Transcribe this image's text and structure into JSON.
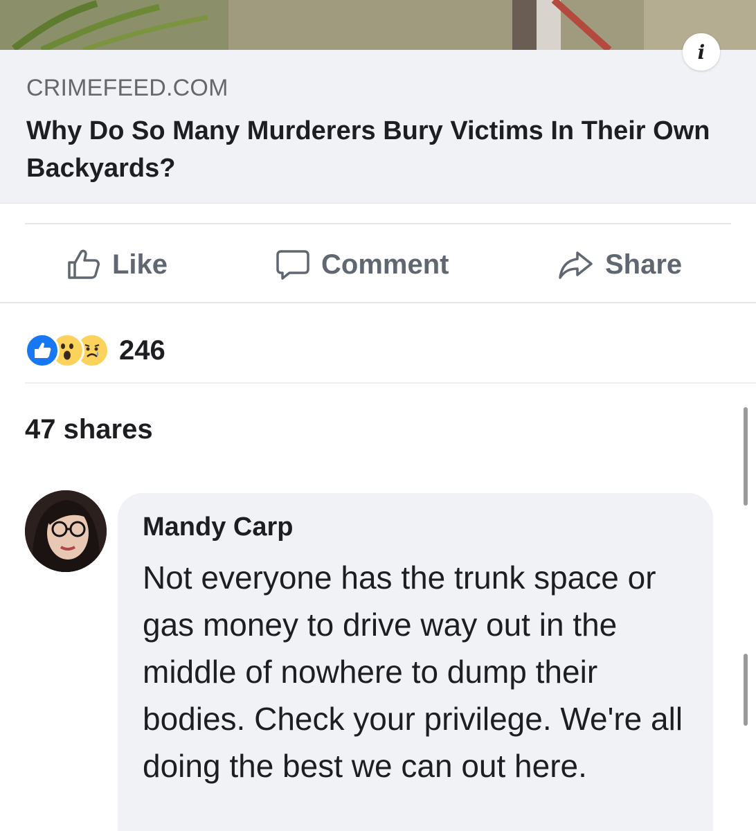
{
  "link_preview": {
    "domain": "CRIMEFEED.COM",
    "headline": "Why Do So Many Murderers Bury Victims In Their Own Backyards?",
    "info_icon": "info-icon",
    "info_label": "i"
  },
  "actions": {
    "like_label": "Like",
    "comment_label": "Comment",
    "share_label": "Share"
  },
  "reactions": {
    "icons": [
      "like-reaction-icon",
      "wow-reaction-icon",
      "sad-reaction-icon"
    ],
    "count": "246"
  },
  "shares_text": "47 shares",
  "comment": {
    "author": "Mandy Carp",
    "text": "Not everyone has the trunk space or gas money to drive way out in the middle of nowhere to dump their bodies. Check your privilege. We're all doing the best we can out here."
  },
  "colors": {
    "preview_background": "#f0f2f5",
    "action_text": "#606770",
    "like_blue": "#1877f2",
    "emoji_yellow": "#fbd25c"
  }
}
